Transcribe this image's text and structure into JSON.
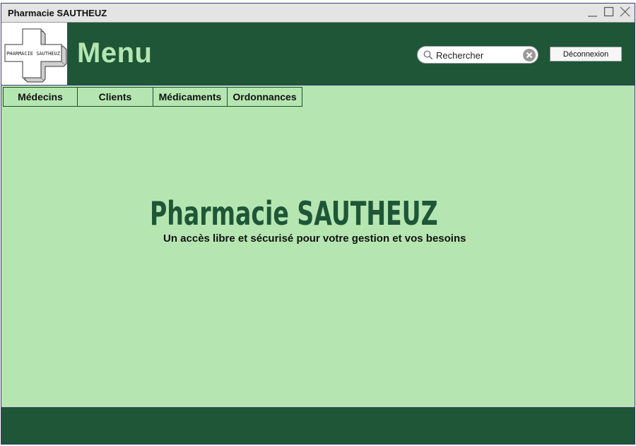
{
  "window": {
    "title": "Pharmacie SAUTHEUZ"
  },
  "header": {
    "logo_text": "PHARMACIE SAUTHEUZ",
    "title": "Menu",
    "search": {
      "placeholder": "Rechercher",
      "value": ""
    },
    "logout_label": "Déconnexion"
  },
  "tabs": [
    {
      "label": "Médecins"
    },
    {
      "label": "Clients"
    },
    {
      "label": "Médicaments"
    },
    {
      "label": "Ordonnances"
    }
  ],
  "hero": {
    "title": "Pharmacie SAUTHEUZ",
    "subtitle": "Un accès libre et sécurisé pour votre gestion et vos besoins"
  },
  "icons": {
    "minimize": "minimize-icon",
    "maximize": "maximize-icon",
    "close": "close-icon",
    "search": "search-icon",
    "clear": "clear-icon",
    "logo": "pharmacy-cross-logo"
  },
  "colors": {
    "header_bg": "#1e5637",
    "content_bg": "#b5e6b1",
    "accent_text": "#b5e6b1",
    "hero_title": "#1e5637"
  }
}
